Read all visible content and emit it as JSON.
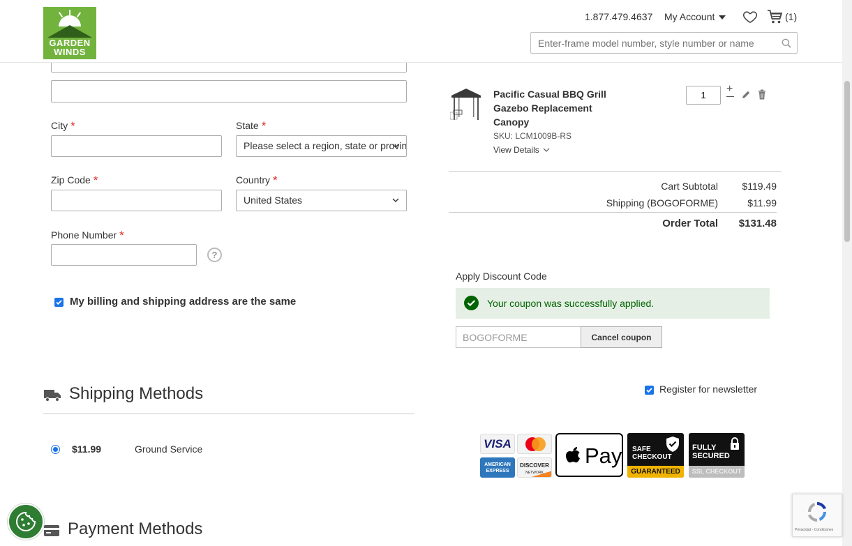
{
  "header": {
    "logo": {
      "line1": "GARDEN",
      "line2": "WINDS"
    },
    "phone": "1.877.479.4637",
    "account_label": "My Account",
    "cart_count": "(1)",
    "search": {
      "placeholder": "Enter-frame model number, style number or name"
    }
  },
  "form": {
    "city_label": "City",
    "state_label": "State",
    "state_value": "Please select a region, state or province.",
    "zip_label": "Zip Code",
    "country_label": "Country",
    "country_value": "United States",
    "phone_label": "Phone Number",
    "required_marker": "*",
    "help_glyph": "?",
    "billing_same_label": "My billing and shipping address are the same",
    "billing_same_checked": true
  },
  "shipping": {
    "title": "Shipping Methods",
    "method_price": "$11.99",
    "method_name": "Ground Service",
    "selected": true
  },
  "payment": {
    "title": "Payment Methods"
  },
  "summary": {
    "item": {
      "name": "Pacific Casual BBQ Grill Gazebo Replacement Canopy",
      "sku": "SKU: LCM1009B-RS",
      "view_details": "View Details",
      "qty": "1",
      "plus": "+"
    },
    "totals": [
      {
        "label": "Cart Subtotal",
        "value": "$119.49"
      },
      {
        "label": "Shipping (BOGOFORME)",
        "value": "$11.99"
      }
    ],
    "order_total_label": "Order Total",
    "order_total_value": "$131.48"
  },
  "discount": {
    "title": "Apply Discount Code",
    "success_message": "Your coupon was successfully applied.",
    "code": "BOGOFORME",
    "cancel_label": "Cancel coupon"
  },
  "newsletter": {
    "label": "Register for newsletter",
    "checked": true
  },
  "badges": {
    "visa": "VISA",
    "amex": "AMERICAN EXPRESS",
    "discover": "DISCOVER",
    "discover_sub": "NETWORK",
    "apple_pay": "Pay",
    "safe_line1": "SAFE",
    "safe_line2": "CHECKOUT",
    "safe_bar": "GUARANTEED",
    "secured_line1": "FULLY",
    "secured_line2": "SECURED",
    "secured_bar": "SSL CHECKOUT"
  },
  "recaptcha": {
    "legal": "Privacidad - Condiciones"
  },
  "colors": {
    "brand_green": "#72b33d",
    "required_red": "#e02b27",
    "success_green": "#006400",
    "success_bg": "#e5efe5",
    "checkbox_blue": "#1a73e8"
  }
}
